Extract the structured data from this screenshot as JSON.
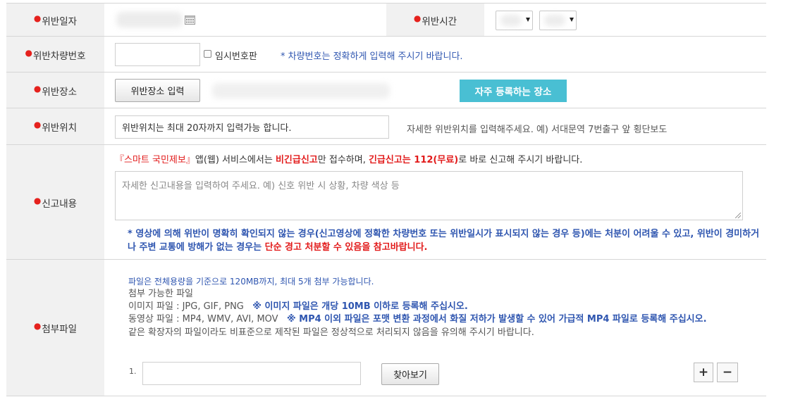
{
  "rows": {
    "date": {
      "label": "위반일자",
      "time_label": "위반시간"
    },
    "vehicle": {
      "label": "위반차량번호",
      "temp_plate_label": "임시번호판",
      "notice": "* 차량번호는 정확하게 입력해 주시기 바랍니다."
    },
    "place": {
      "label": "위반장소",
      "input_button": "위반장소 입력",
      "favorites_button": "자주 등록하는 장소"
    },
    "location": {
      "label": "위반위치",
      "input_value": "위반위치는 최대 20자까지 입력가능 합니다.",
      "hint": "자세한 위반위치를 입력해주세요. 예) 서대문역 7번출구 앞 횡단보도"
    },
    "report": {
      "label": "신고내용",
      "notice_app": "『스마트 국민제보』",
      "notice_p1": "앱(웹) 서비스에서는 ",
      "notice_non_emergency": "비긴급신고",
      "notice_p2": "만 접수하며, ",
      "notice_emergency": "긴급신고는 112(무료)",
      "notice_p3": "로 바로 신고해 주시기 바랍니다.",
      "placeholder": "자세한 신고내용을 입력하여 주세요. 예) 신호 위반 시 상황, 차량 색상 등",
      "warning_blue": "* 영상에 의해 위반이 명확히 확인되지 않는 경우(신고영상에 정확한 차량번호 또는 위반일시가 표시되지 않는 경우 등)에는 처분이 어려울 수 있고, 위반이 경미하거나 주변 교통에 방해가 없는 경우는 ",
      "warning_red": "단순 경고 처분할 수 있음을 참고바랍니다."
    },
    "attachment": {
      "label": "첨부파일",
      "line1": "파일은 전체용량을 기준으로 120MB까지, 최대 5개 첨부 가능합니다.",
      "line2": "첨부 가능한 파일",
      "image_types": "이미지 파일 : JPG, GIF, PNG",
      "image_note": "※ 이미지 파일은 개당 10MB 이하로 등록해 주십시오.",
      "video_types": "동영상 파일 : MP4, WMV, AVI, MOV",
      "video_note": "※ MP4 이외 파일은 포맷 변환 과정에서 화질 저하가 발생할 수 있어 가급적 MP4 파일로 등록해 주십시오.",
      "nonstandard_note": "같은 확장자의 파일이라도 비표준으로 제작된 파일은 정상적으로 처리되지 않음을 유의해 주시기 바랍니다.",
      "file_index": "1.",
      "browse_button": "찾아보기",
      "add_button": "+",
      "remove_button": "−"
    }
  },
  "colors": {
    "required_dot": "#e5211d",
    "label_bg": "#f1f1f1",
    "accent_teal": "#49bfd3",
    "notice_blue": "#2f56b0",
    "notice_red": "#e21b1b"
  },
  "icons": [
    "calendar-icon",
    "chevron-down-icon",
    "required-dot-icon",
    "plus-icon",
    "minus-icon"
  ]
}
